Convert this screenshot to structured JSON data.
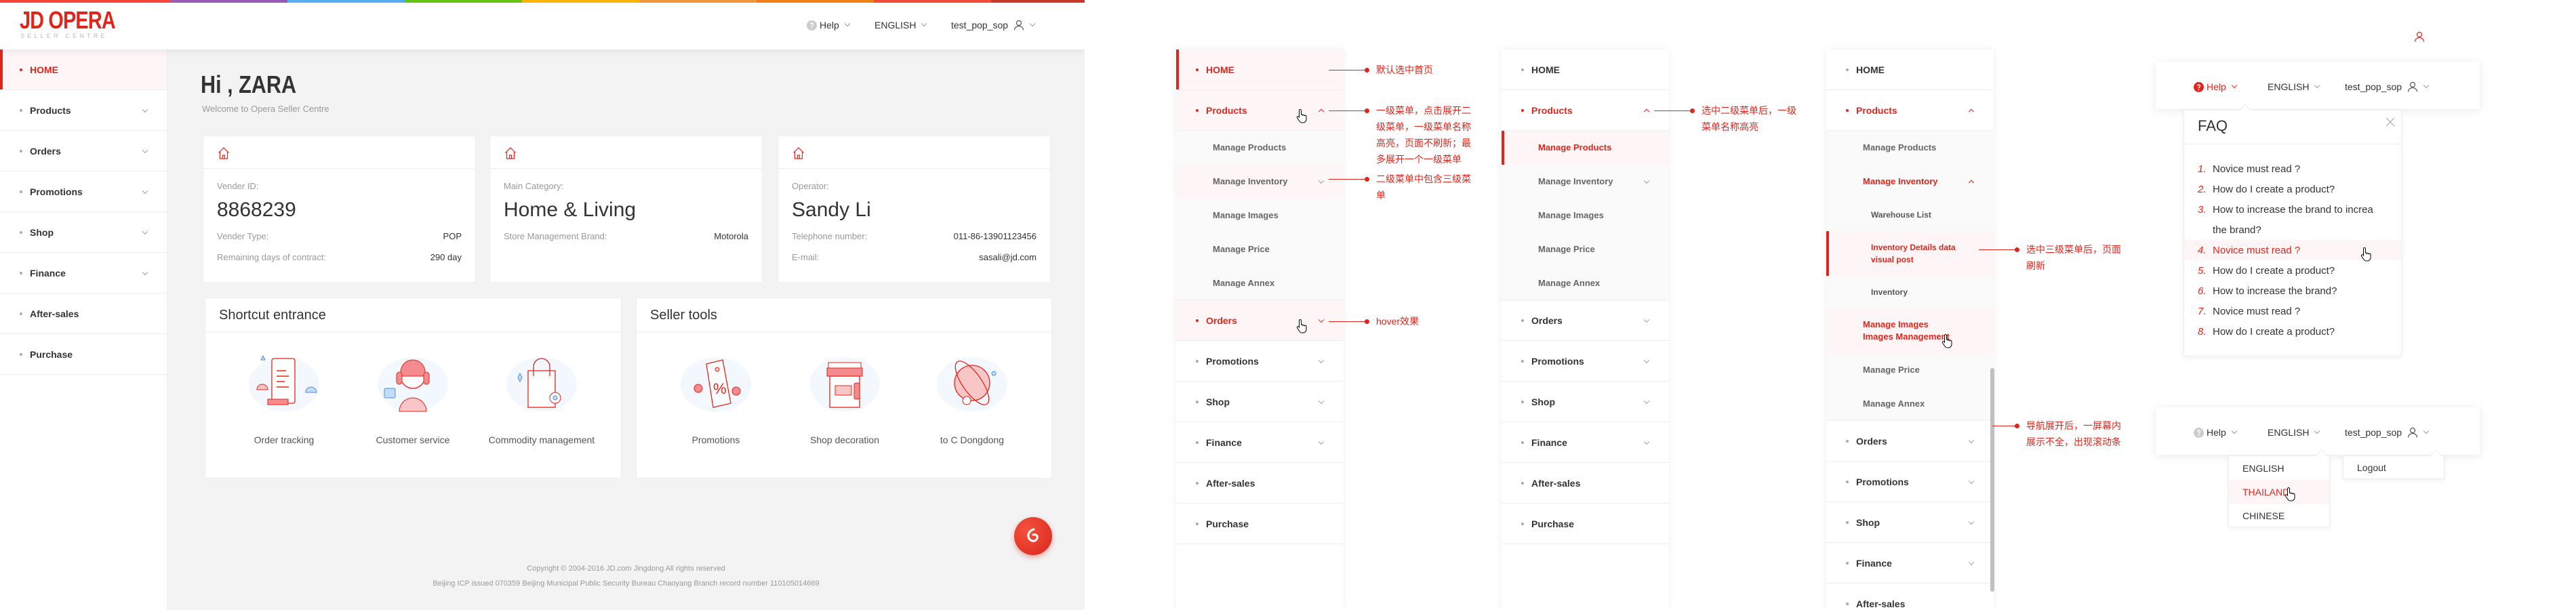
{
  "main": {
    "logo": {
      "title": "JD OPERA",
      "subtitle": "SELLER CENTRE"
    },
    "header": {
      "help": "Help",
      "language": "ENGLISH",
      "user": "test_pop_sop"
    },
    "sidebar": [
      {
        "label": "HOME",
        "level": 1,
        "selected": true
      },
      {
        "label": "Products",
        "level": 1,
        "chevron": "down"
      },
      {
        "label": "Orders",
        "level": 1,
        "chevron": "down"
      },
      {
        "label": "Promotions",
        "level": 1,
        "chevron": "down"
      },
      {
        "label": "Shop",
        "level": 1,
        "chevron": "down"
      },
      {
        "label": "Finance",
        "level": 1,
        "chevron": "down"
      },
      {
        "label": "After-sales",
        "level": 1
      },
      {
        "label": "Purchase",
        "level": 1
      }
    ],
    "greeting": "Hi , ZARA",
    "welcome": "Welcome to Opera Seller Centre",
    "cards": [
      {
        "label": "Vender ID:",
        "value": "8868239",
        "rows": [
          {
            "k": "Vender Type:",
            "v": "POP"
          },
          {
            "k": "Remaining days of contract:",
            "v": "290 day"
          }
        ]
      },
      {
        "label": "Main Category:",
        "value": "Home & Living",
        "rows": [
          {
            "k": "Store Management Brand:",
            "v": "Motorola"
          }
        ]
      },
      {
        "label": "Operator:",
        "value": "Sandy Li",
        "rows": [
          {
            "k": "Telephone number:",
            "v": "011-86-13901123456"
          },
          {
            "k": "E-mail:",
            "v": "sasali@jd.com"
          }
        ]
      }
    ],
    "shortcut": {
      "title": "Shortcut entrance",
      "items": [
        "Order tracking",
        "Customer service",
        "Commodity management"
      ]
    },
    "seller_tools": {
      "title": "Seller tools",
      "items": [
        "Promotions",
        "Shop decoration",
        "to C Dongdong"
      ]
    },
    "footer": {
      "copyright": "Copyright © 2004-2016 JD.com Jingdong All rights reserved",
      "icp": "Beijing ICP issued 070359 Beijing Municipal Public Security Bureau Chaoyang Branch record number 110105014669"
    },
    "colors": {
      "accent": "#e1251b",
      "background": "#f3f3f3"
    }
  },
  "panels": [
    {
      "items": [
        {
          "label": "HOME",
          "level": 1,
          "selected": true
        },
        {
          "label": "Products",
          "level": 1,
          "highlighted": true,
          "hovered": true,
          "chevron": "up"
        },
        {
          "label": "Manage Products",
          "level": 2
        },
        {
          "label": "Manage Inventory",
          "level": 2,
          "hovered": true,
          "chevron": "down"
        },
        {
          "label": "Manage Images",
          "level": 2
        },
        {
          "label": "Manage Price",
          "level": 2
        },
        {
          "label": "Manage Annex",
          "level": 2
        },
        {
          "label": "Orders",
          "level": 1,
          "highlighted": true,
          "hovered": true,
          "chevron": "down"
        },
        {
          "label": "Promotions",
          "level": 1,
          "chevron": "down"
        },
        {
          "label": "Shop",
          "level": 1,
          "chevron": "down"
        },
        {
          "label": "Finance",
          "level": 1,
          "chevron": "down"
        },
        {
          "label": "After-sales",
          "level": 1
        },
        {
          "label": "Purchase",
          "level": 1
        }
      ],
      "annotations": [
        "默认选中首页",
        "一级菜单，点击展开二级菜单，一级菜单名称高亮，页面不刷新；最多展开一个一级菜单",
        "二级菜单中包含三级菜单",
        "hover效果"
      ]
    },
    {
      "items": [
        {
          "label": "HOME",
          "level": 1
        },
        {
          "label": "Products",
          "level": 1,
          "highlighted": true,
          "chevron": "up"
        },
        {
          "label": "Manage Products",
          "level": 2,
          "selected": true
        },
        {
          "label": "Manage Inventory",
          "level": 2,
          "chevron": "down"
        },
        {
          "label": "Manage Images",
          "level": 2
        },
        {
          "label": "Manage Price",
          "level": 2
        },
        {
          "label": "Manage Annex",
          "level": 2
        },
        {
          "label": "Orders",
          "level": 1,
          "chevron": "down"
        },
        {
          "label": "Promotions",
          "level": 1,
          "chevron": "down"
        },
        {
          "label": "Shop",
          "level": 1,
          "chevron": "down"
        },
        {
          "label": "Finance",
          "level": 1,
          "chevron": "down"
        },
        {
          "label": "After-sales",
          "level": 1
        },
        {
          "label": "Purchase",
          "level": 1
        }
      ],
      "annotations": [
        "选中二级菜单后，一级菜单名称高亮"
      ]
    },
    {
      "items": [
        {
          "label": "HOME",
          "level": 1
        },
        {
          "label": "Products",
          "level": 1,
          "highlighted": true,
          "chevron": "up"
        },
        {
          "label": "Manage Products",
          "level": 2
        },
        {
          "label": "Manage Inventory",
          "level": 2,
          "highlighted": true,
          "chevron": "up"
        },
        {
          "label": "Warehouse List",
          "level": 3
        },
        {
          "label": "Inventory Details data visual post",
          "level": 3,
          "selected": true,
          "lines": 2
        },
        {
          "label": "Inventory",
          "level": 3
        },
        {
          "label": "Manage Images\nImages Management",
          "level": 2,
          "highlighted": true,
          "hovered": true,
          "lines": 2
        },
        {
          "label": "Manage Price",
          "level": 2
        },
        {
          "label": "Manage Annex",
          "level": 2
        },
        {
          "label": "Orders",
          "level": 1,
          "chevron": "down"
        },
        {
          "label": "Promotions",
          "level": 1,
          "chevron": "down"
        },
        {
          "label": "Shop",
          "level": 1,
          "chevron": "down"
        },
        {
          "label": "Finance",
          "level": 1,
          "chevron": "down"
        },
        {
          "label": "After-sales",
          "level": 1
        }
      ],
      "annotations": [
        "选中三级菜单后，页面刷新",
        "导航展开后，一屏幕内展示不全，出现滚动条"
      ]
    }
  ],
  "help_demo": {
    "header": {
      "help": "Help",
      "language": "ENGLISH",
      "user": "test_pop_sop"
    },
    "faq": {
      "title": "FAQ",
      "items": [
        {
          "n": "1.",
          "text": "Novice must read ?"
        },
        {
          "n": "2.",
          "text": "How do I create a product?"
        },
        {
          "n": "3.",
          "text": "How to increase the brand to increa"
        },
        {
          "n": "",
          "text": "the brand?"
        },
        {
          "n": "4.",
          "text": "Novice must read ?"
        },
        {
          "n": "5.",
          "text": "How do I create a product?"
        },
        {
          "n": "6.",
          "text": "How to increase the brand?"
        },
        {
          "n": "7.",
          "text": "Novice must read ?"
        },
        {
          "n": "8.",
          "text": "How do I create a product?"
        }
      ]
    }
  },
  "language_demo": {
    "header": {
      "help": "Help",
      "language": "ENGLISH",
      "user": "test_pop_sop"
    },
    "languages": [
      "ENGLISH",
      "THAILAND",
      "CHINESE"
    ],
    "user_menu": [
      "Logout"
    ]
  }
}
